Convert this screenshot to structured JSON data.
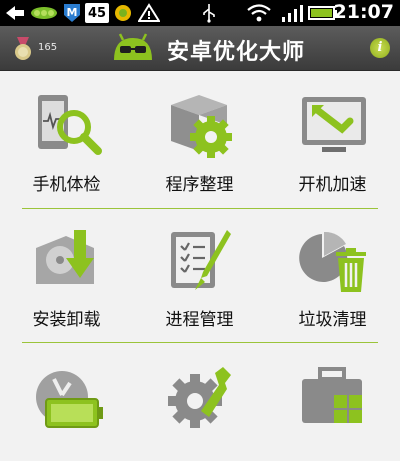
{
  "status_bar": {
    "time": "21:07",
    "notification_badge": "45",
    "icons": [
      "back-arrow-icon",
      "pea-pod-icon",
      "m-shield-icon",
      "number-badge-icon",
      "weather-icon",
      "warning-icon",
      "usb-icon",
      "wifi-icon",
      "signal-icon",
      "battery-icon"
    ]
  },
  "header": {
    "title": "安卓优化大师",
    "medal_count": "165",
    "info_label": "i",
    "accent_color": "#8dc21f"
  },
  "tiles": [
    {
      "label": "手机体检",
      "icon": "phone-check-icon"
    },
    {
      "label": "程序整理",
      "icon": "app-organize-icon"
    },
    {
      "label": "开机加速",
      "icon": "boot-speed-icon"
    },
    {
      "label": "安装卸载",
      "icon": "install-uninstall-icon"
    },
    {
      "label": "进程管理",
      "icon": "process-manager-icon"
    },
    {
      "label": "垃圾清理",
      "icon": "junk-clean-icon"
    },
    {
      "label": "",
      "icon": "battery-manager-icon"
    },
    {
      "label": "",
      "icon": "system-tools-icon"
    },
    {
      "label": "",
      "icon": "toolbox-icon"
    }
  ]
}
